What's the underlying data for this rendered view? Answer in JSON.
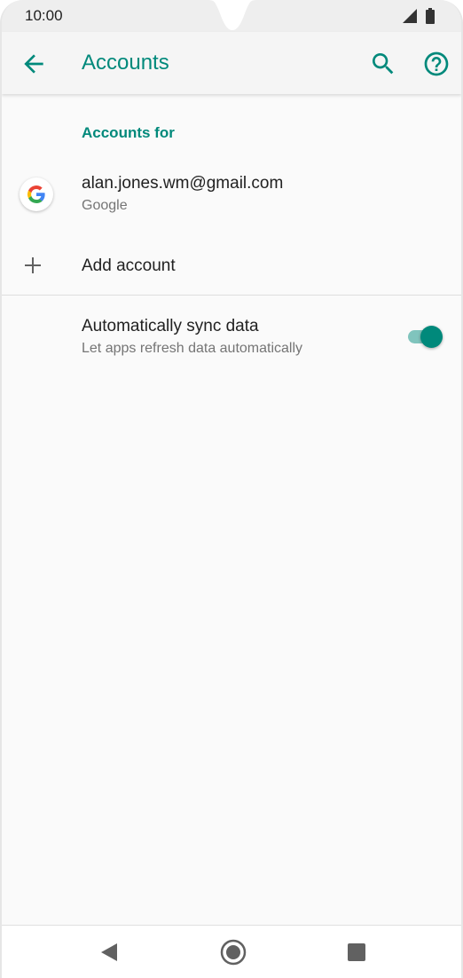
{
  "status_bar": {
    "time": "10:00",
    "icons": [
      "signal-icon",
      "battery-icon"
    ]
  },
  "app_bar": {
    "title": "Accounts",
    "icons": [
      "back-arrow-icon",
      "search-icon",
      "help-icon"
    ]
  },
  "accounts": {
    "section_header": "Accounts for",
    "items": [
      {
        "email": "alan.jones.wm@gmail.com",
        "type": "Google",
        "icon": "google-logo-icon"
      }
    ],
    "add_label": "Add account"
  },
  "sync": {
    "title": "Automatically sync data",
    "subtitle": "Let apps refresh data automatically",
    "enabled": true
  },
  "nav_bar": {
    "icons": [
      "nav-back-icon",
      "nav-home-icon",
      "nav-recents-icon"
    ]
  },
  "colors": {
    "accent": "#00897b",
    "toggle_track": "#80c4bd",
    "background": "#fafafa"
  }
}
